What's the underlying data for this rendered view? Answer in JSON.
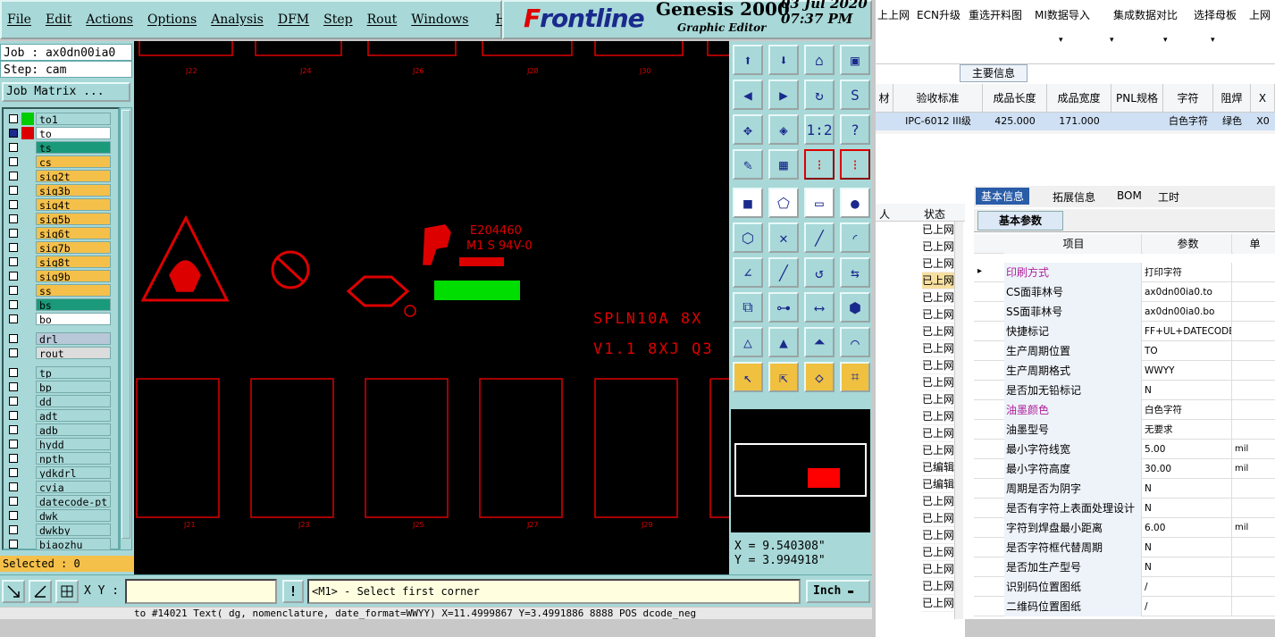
{
  "menu": {
    "items": [
      "File",
      "Edit",
      "Actions",
      "Options",
      "Analysis",
      "DFM",
      "Step",
      "Rout",
      "Windows"
    ],
    "help": "Help"
  },
  "logo": {
    "brand_f": "F",
    "brand_rest": "rontline",
    "product": "Genesis 2000",
    "subtitle": "Graphic Editor",
    "date": "03 Jul 2020",
    "time": "07:37 PM"
  },
  "job": {
    "job_label": "Job : ax0dn00ia0",
    "step_label": "Step: cam",
    "job_matrix_button": "Job Matrix ..."
  },
  "layers": [
    {
      "name": "to1",
      "color": "#00cc00",
      "bg": "#a8d8d8",
      "checked": false
    },
    {
      "name": "to",
      "color": "#dd0000",
      "bg": "#ffffff",
      "checked": true
    },
    {
      "name": "ts",
      "color": "",
      "bg": "#1a9a7a",
      "checked": false
    },
    {
      "name": "cs",
      "color": "",
      "bg": "#f5c04a",
      "checked": false
    },
    {
      "name": "sig2t",
      "color": "",
      "bg": "#f5c04a",
      "checked": false
    },
    {
      "name": "sig3b",
      "color": "",
      "bg": "#f5c04a",
      "checked": false
    },
    {
      "name": "sig4t",
      "color": "",
      "bg": "#f5c04a",
      "checked": false
    },
    {
      "name": "sig5b",
      "color": "",
      "bg": "#f5c04a",
      "checked": false
    },
    {
      "name": "sig6t",
      "color": "",
      "bg": "#f5c04a",
      "checked": false
    },
    {
      "name": "sig7b",
      "color": "",
      "bg": "#f5c04a",
      "checked": false
    },
    {
      "name": "sig8t",
      "color": "",
      "bg": "#f5c04a",
      "checked": false
    },
    {
      "name": "sig9b",
      "color": "",
      "bg": "#f5c04a",
      "checked": false
    },
    {
      "name": "ss",
      "color": "",
      "bg": "#f5c04a",
      "checked": false
    },
    {
      "name": "bs",
      "color": "",
      "bg": "#1a9a7a",
      "checked": false
    },
    {
      "name": "bo",
      "color": "",
      "bg": "#ffffff",
      "checked": false
    },
    {
      "name": "drl",
      "color": "",
      "bg": "#b8c8d8",
      "checked": false
    },
    {
      "name": "rout",
      "color": "",
      "bg": "#dcdcdc",
      "checked": false
    },
    {
      "name": "tp",
      "color": "",
      "bg": "#a8d8d8",
      "checked": false
    },
    {
      "name": "bp",
      "color": "",
      "bg": "#a8d8d8",
      "checked": false
    },
    {
      "name": "dd",
      "color": "",
      "bg": "#a8d8d8",
      "checked": false
    },
    {
      "name": "adt",
      "color": "",
      "bg": "#a8d8d8",
      "checked": false
    },
    {
      "name": "adb",
      "color": "",
      "bg": "#a8d8d8",
      "checked": false
    },
    {
      "name": "hydd",
      "color": "",
      "bg": "#a8d8d8",
      "checked": false
    },
    {
      "name": "npth",
      "color": "",
      "bg": "#a8d8d8",
      "checked": false
    },
    {
      "name": "ydkdrl",
      "color": "",
      "bg": "#a8d8d8",
      "checked": false
    },
    {
      "name": "cvia",
      "color": "",
      "bg": "#a8d8d8",
      "checked": false
    },
    {
      "name": "datecode-pt",
      "color": "",
      "bg": "#a8d8d8",
      "checked": false
    },
    {
      "name": "dwk",
      "color": "",
      "bg": "#a8d8d8",
      "checked": false
    },
    {
      "name": "dwkby",
      "color": "",
      "bg": "#a8d8d8",
      "checked": false
    },
    {
      "name": "biaozhu",
      "color": "",
      "bg": "#a8d8d8",
      "checked": false
    }
  ],
  "selected": "Selected : 0",
  "canvas": {
    "ul_text": "E204460",
    "ul_text2": "M1 S 94V-0",
    "part_text": "SPLN10A   8X",
    "version_text": "V1.1   8XJ Q3",
    "top_labels": [
      "J22",
      "J24",
      "J26",
      "J28",
      "J30"
    ],
    "bottom_labels": [
      "J21",
      "J23",
      "J25",
      "J27",
      "J29"
    ]
  },
  "coords": {
    "x": "X = 9.540308\"",
    "y": "Y = 3.994918\""
  },
  "bottom": {
    "xy_label": "X Y :",
    "prompt": "<M1> - Select first corner",
    "unit": "Inch",
    "cmdline": "to #14021 Text( dg, nomenclature, date_format=WWYY) X=11.4999867 Y=3.4991886 8888 POS dcode_neg"
  },
  "right": {
    "toolbar": [
      "上上网",
      "ECN升级",
      "重选开料图",
      "MI数据导入",
      "集成",
      "数据对比",
      "选择母板",
      "上网"
    ],
    "main_info_tab": "主要信息",
    "grid_headers": [
      "材",
      "验收标准",
      "成品长度",
      "成品宽度",
      "PNL规格",
      "字符",
      "阻焊",
      "X"
    ],
    "grid_row": [
      "",
      "IPC-6012 III级",
      "425.000",
      "171.000",
      "",
      "白色字符",
      "绿色",
      "X0"
    ],
    "left_headers": [
      "人",
      "状态"
    ],
    "status_values": [
      "已上网",
      "已上网",
      "已上网",
      "已上网",
      "已上网",
      "已上网",
      "已上网",
      "已上网",
      "已上网",
      "已上网",
      "已上网",
      "已上网",
      "已上网",
      "已上网",
      "已编辑",
      "已编辑",
      "已上网",
      "已上网",
      "已上网",
      "已上网",
      "已上网",
      "已上网",
      "已上网"
    ],
    "tabs": [
      "基本信息",
      "拓展信息",
      "BOM",
      "工时"
    ],
    "subtab": "基本参数",
    "param_headers": [
      "项目",
      "参数",
      "单"
    ],
    "params": [
      {
        "k": "印刷方式",
        "v": "打印字符",
        "u": "",
        "hl": true
      },
      {
        "k": "CS面菲林号",
        "v": "ax0dn00ia0.to",
        "u": ""
      },
      {
        "k": "SS面菲林号",
        "v": "ax0dn00ia0.bo",
        "u": ""
      },
      {
        "k": "快捷标记",
        "v": "FF+UL+DATECODE",
        "u": ""
      },
      {
        "k": "生产周期位置",
        "v": "TO",
        "u": ""
      },
      {
        "k": "生产周期格式",
        "v": "WWYY",
        "u": ""
      },
      {
        "k": "是否加无铅标记",
        "v": "N",
        "u": ""
      },
      {
        "k": "油墨颜色",
        "v": "白色字符",
        "u": "",
        "hl": true
      },
      {
        "k": "油墨型号",
        "v": "无要求",
        "u": ""
      },
      {
        "k": "最小字符线宽",
        "v": "5.00",
        "u": "mil"
      },
      {
        "k": "最小字符高度",
        "v": "30.00",
        "u": "mil"
      },
      {
        "k": "周期是否为阴字",
        "v": "N",
        "u": ""
      },
      {
        "k": "是否有字符上表面处理设计",
        "v": "N",
        "u": ""
      },
      {
        "k": "字符到焊盘最小距离",
        "v": "6.00",
        "u": "mil"
      },
      {
        "k": "是否字符框代替周期",
        "v": "N",
        "u": ""
      },
      {
        "k": "是否加生产型号",
        "v": "N",
        "u": ""
      },
      {
        "k": "识别码位置图纸",
        "v": "/",
        "u": ""
      },
      {
        "k": "二维码位置图纸",
        "v": "/",
        "u": ""
      }
    ]
  }
}
